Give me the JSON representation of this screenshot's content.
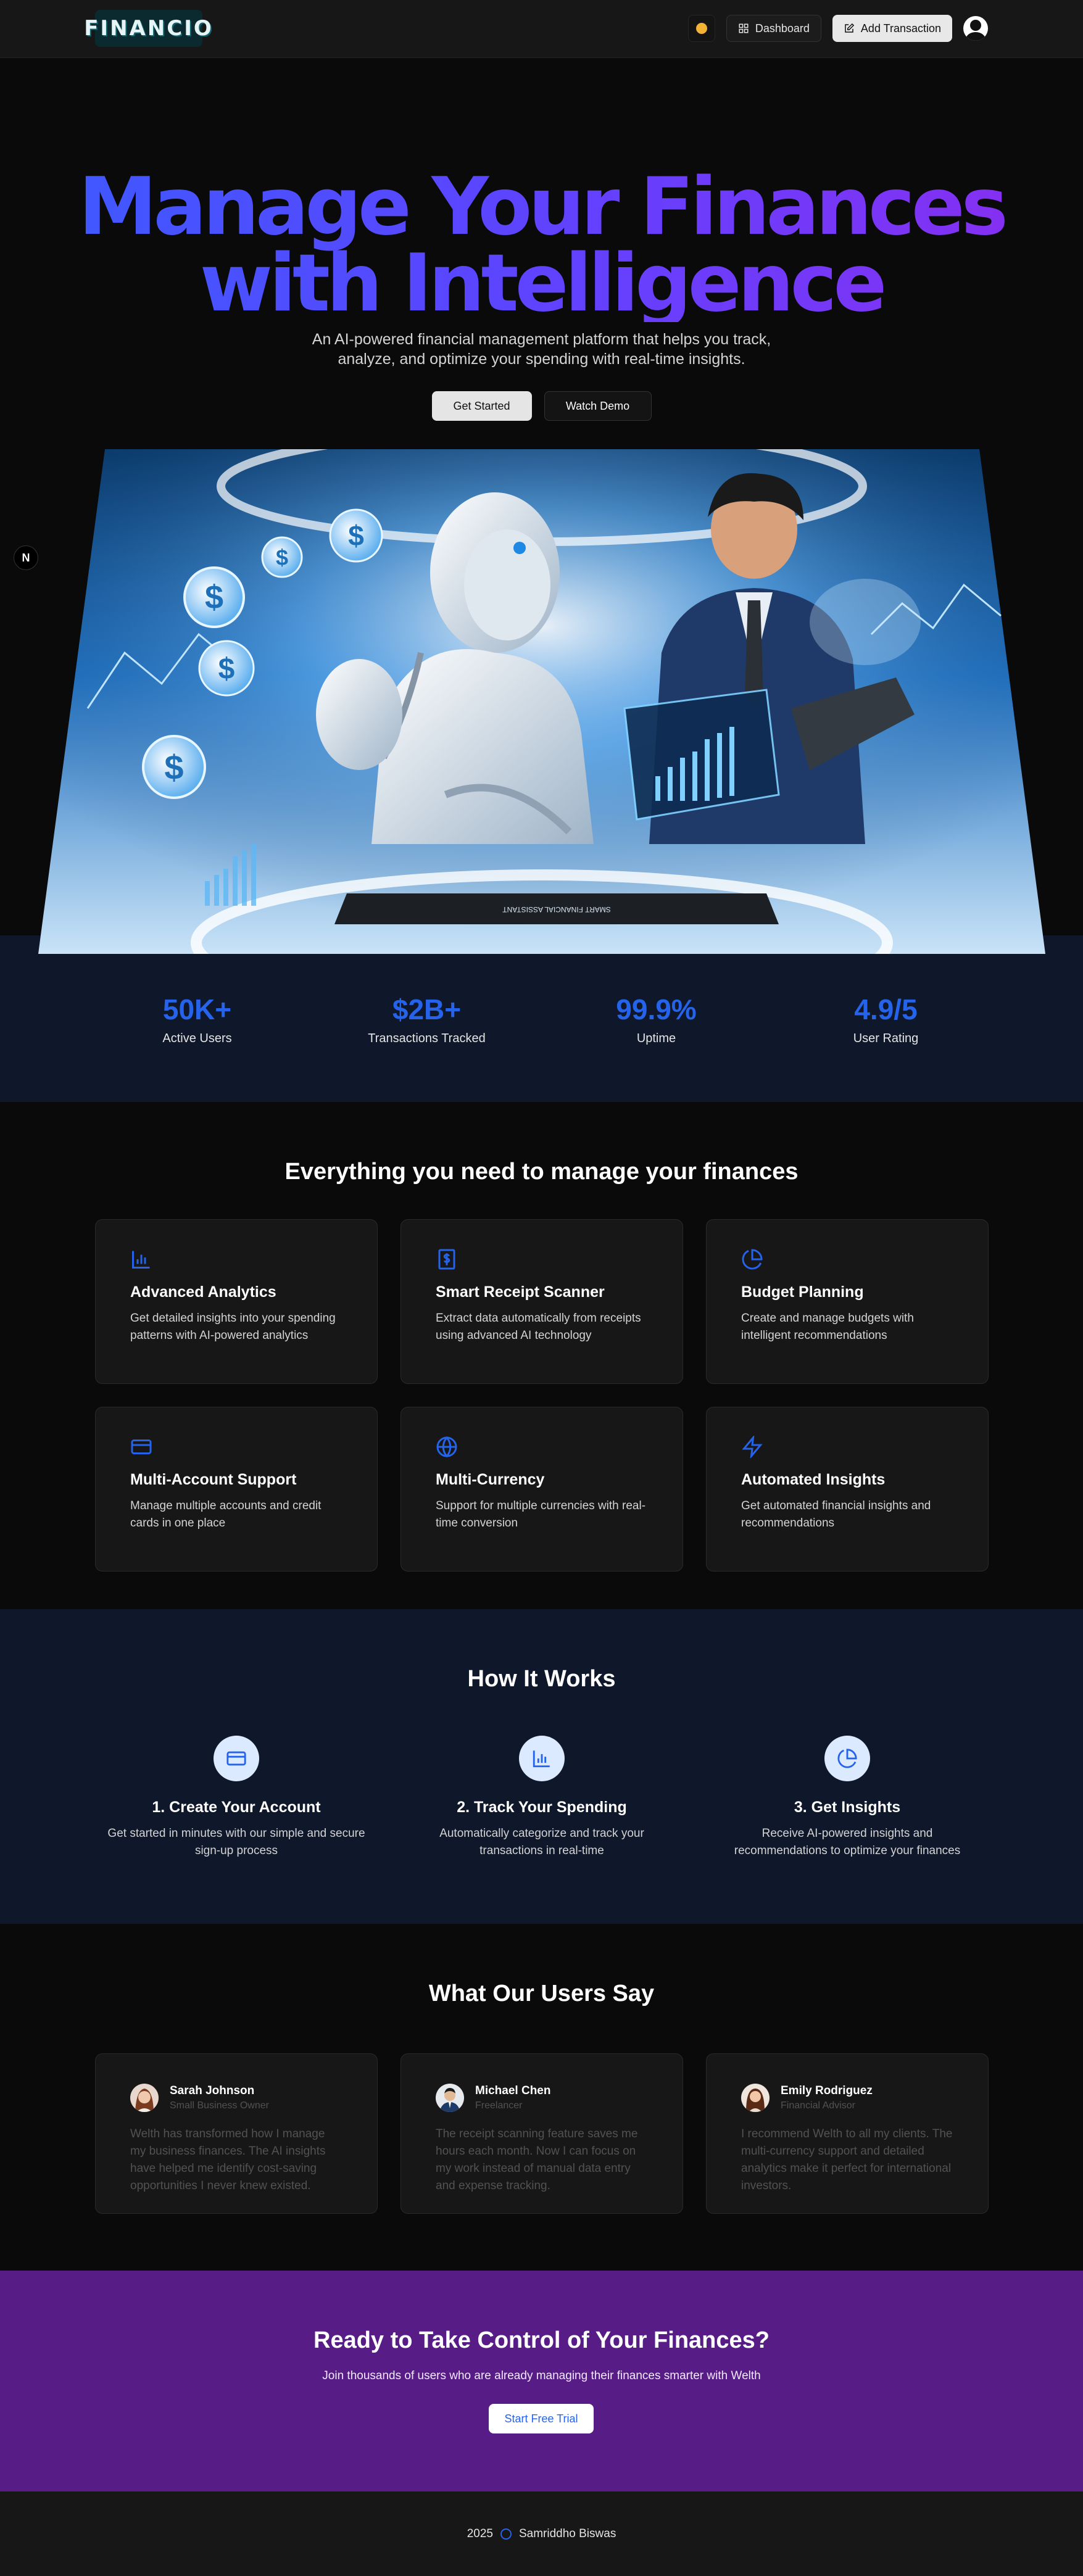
{
  "nav": {
    "logo_text": "FINANCIO",
    "dashboard_label": "Dashboard",
    "add_transaction_label": "Add Transaction"
  },
  "hero": {
    "title_line1": "Manage Your Finances",
    "title_line2": "with Intelligence",
    "subtitle_line1": "An AI-powered financial management platform that helps you track,",
    "subtitle_line2": "analyze, and optimize your spending with real-time insights.",
    "primary_button": "Get Started",
    "secondary_button": "Watch Demo",
    "side_badge": "N",
    "image_caption": "SMART FINANCIAL ASSISTANT"
  },
  "stats": [
    {
      "value": "50K+",
      "label": "Active Users"
    },
    {
      "value": "$2B+",
      "label": "Transactions Tracked"
    },
    {
      "value": "99.9%",
      "label": "Uptime"
    },
    {
      "value": "4.9/5",
      "label": "User Rating"
    }
  ],
  "features": {
    "title": "Everything you need to manage your finances",
    "items": [
      {
        "icon": "bar-chart-icon",
        "title": "Advanced Analytics",
        "desc": "Get detailed insights into your spending patterns with AI-powered analytics"
      },
      {
        "icon": "receipt-icon",
        "title": "Smart Receipt Scanner",
        "desc": "Extract data automatically from receipts using advanced AI technology"
      },
      {
        "icon": "pie-chart-icon",
        "title": "Budget Planning",
        "desc": "Create and manage budgets with intelligent recommendations"
      },
      {
        "icon": "credit-card-icon",
        "title": "Multi-Account Support",
        "desc": "Manage multiple accounts and credit cards in one place"
      },
      {
        "icon": "globe-icon",
        "title": "Multi-Currency",
        "desc": "Support for multiple currencies with real-time conversion"
      },
      {
        "icon": "zap-icon",
        "title": "Automated Insights",
        "desc": "Get automated financial insights and recommendations"
      }
    ]
  },
  "how": {
    "title": "How It Works",
    "steps": [
      {
        "icon": "credit-card-icon",
        "title": "1. Create Your Account",
        "desc": "Get started in minutes with our simple and secure sign-up process"
      },
      {
        "icon": "bar-chart-icon",
        "title": "2. Track Your Spending",
        "desc": "Automatically categorize and track your transactions in real-time"
      },
      {
        "icon": "pie-chart-icon",
        "title": "3. Get Insights",
        "desc": "Receive AI-powered insights and recommendations to optimize your finances"
      }
    ]
  },
  "testimonials": {
    "title": "What Our Users Say",
    "items": [
      {
        "name": "Sarah Johnson",
        "role": "Small Business Owner",
        "quote": "Welth has transformed how I manage my business finances. The AI insights have helped me identify cost-saving opportunities I never knew existed."
      },
      {
        "name": "Michael Chen",
        "role": "Freelancer",
        "quote": "The receipt scanning feature saves me hours each month. Now I can focus on my work instead of manual data entry and expense tracking."
      },
      {
        "name": "Emily Rodriguez",
        "role": "Financial Advisor",
        "quote": "I recommend Welth to all my clients. The multi-currency support and detailed analytics make it perfect for international investors."
      }
    ]
  },
  "cta": {
    "title": "Ready to Take Control of Your Finances?",
    "subtitle": "Join thousands of users who are already managing their finances smarter with Welth",
    "button": "Start Free Trial"
  },
  "footer": {
    "year": "2025",
    "author": "Samriddho Biswas"
  },
  "colors": {
    "accent": "#2563eb",
    "cta_bg": "#581c87",
    "section_alt_bg": "#0f172a"
  }
}
